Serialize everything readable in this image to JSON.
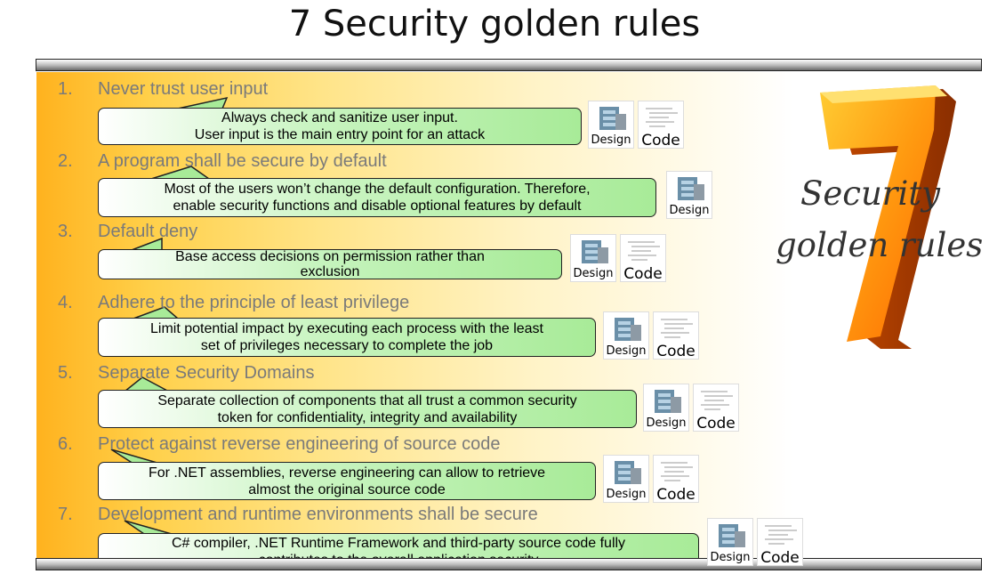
{
  "title": "7 Security golden rules",
  "emblem": {
    "digit": "7",
    "line1": "Security",
    "line2": "golden rules"
  },
  "badge_labels": {
    "design": "Design",
    "code": "Code"
  },
  "rules": [
    {
      "number": "1.",
      "heading": "Never trust user input",
      "callout": [
        "Always check and sanitize user input.",
        "User input is the main entry point for an attack"
      ],
      "badges": [
        "Design",
        "Code"
      ]
    },
    {
      "number": "2.",
      "heading": "A program shall be secure by default",
      "callout": [
        "Most of the users won’t change the default configuration. Therefore,",
        "enable security functions and disable optional features by default"
      ],
      "badges": [
        "Design"
      ]
    },
    {
      "number": "3.",
      "heading": "Default deny",
      "callout": [
        "Base access decisions on permission rather than",
        "exclusion"
      ],
      "badges": [
        "Design",
        "Code"
      ]
    },
    {
      "number": "4.",
      "heading": "Adhere to the principle of least privilege",
      "callout": [
        "Limit potential impact by executing each process with the least",
        "set of privileges necessary to complete the job"
      ],
      "badges": [
        "Design",
        "Code"
      ]
    },
    {
      "number": "5.",
      "heading": "Separate Security Domains",
      "callout": [
        "Separate collection of components that all trust a common security",
        "token for confidentiality, integrity and availability"
      ],
      "badges": [
        "Design",
        "Code"
      ]
    },
    {
      "number": "6.",
      "heading": "Protect against reverse engineering of source code",
      "callout": [
        "For .NET assemblies, reverse engineering can allow to retrieve",
        "almost the original source code"
      ],
      "badges": [
        "Design",
        "Code"
      ]
    },
    {
      "number": "7.",
      "heading": "Development and runtime environments shall be secure",
      "callout": [
        "C# compiler, .NET Runtime Framework and third-party source code fully",
        "contributes to the overall application security"
      ],
      "badges": [
        "Design",
        "Code"
      ]
    }
  ],
  "colors": {
    "panel_gradient_start": "#ffb21e",
    "callout_fill": "#a8eb98",
    "heading_text": "#7a7a7a",
    "emblem_digit": "#ff8a00"
  }
}
